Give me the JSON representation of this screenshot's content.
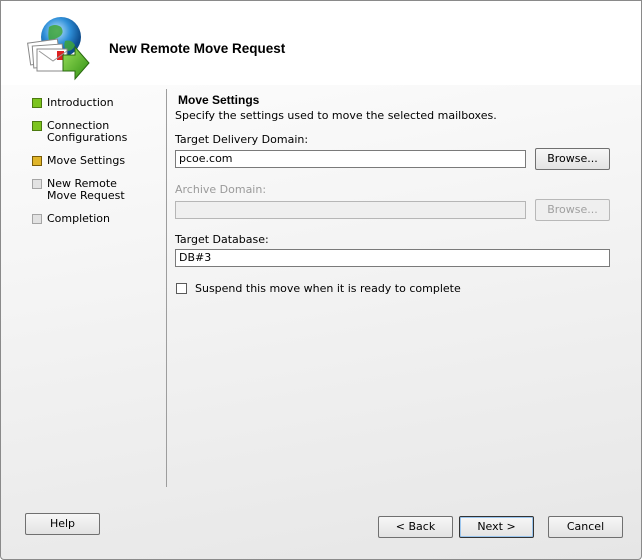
{
  "wizard": {
    "title": "New Remote Move Request"
  },
  "nav": {
    "items": [
      {
        "label": "Introduction",
        "state": "done"
      },
      {
        "label": "Connection Configurations",
        "state": "done"
      },
      {
        "label": "Move Settings",
        "state": "current"
      },
      {
        "label": "New Remote Move Request",
        "state": "pending"
      },
      {
        "label": "Completion",
        "state": "pending"
      }
    ]
  },
  "page": {
    "section_title": "Move Settings",
    "description": "Specify the settings used to move the selected mailboxes.",
    "target_domain_label": "Target Delivery Domain:",
    "target_domain_value": "pcoe.com",
    "browse_label": "Browse...",
    "archive_domain_label": "Archive Domain:",
    "archive_domain_value": "",
    "archive_browse_label": "Browse...",
    "target_db_label": "Target Database:",
    "target_db_value": "DB#3",
    "suspend_label": "Suspend this move when it is ready to complete",
    "suspend_checked": false
  },
  "footer": {
    "help_label": "Help",
    "back_label": "< Back",
    "next_label": "Next >",
    "cancel_label": "Cancel"
  },
  "colors": {
    "done": "#7cc41e",
    "current": "#e0b52a",
    "pending": "#e2e2e2"
  },
  "icons": {
    "wizard": "globe-envelopes-arrow-icon"
  }
}
